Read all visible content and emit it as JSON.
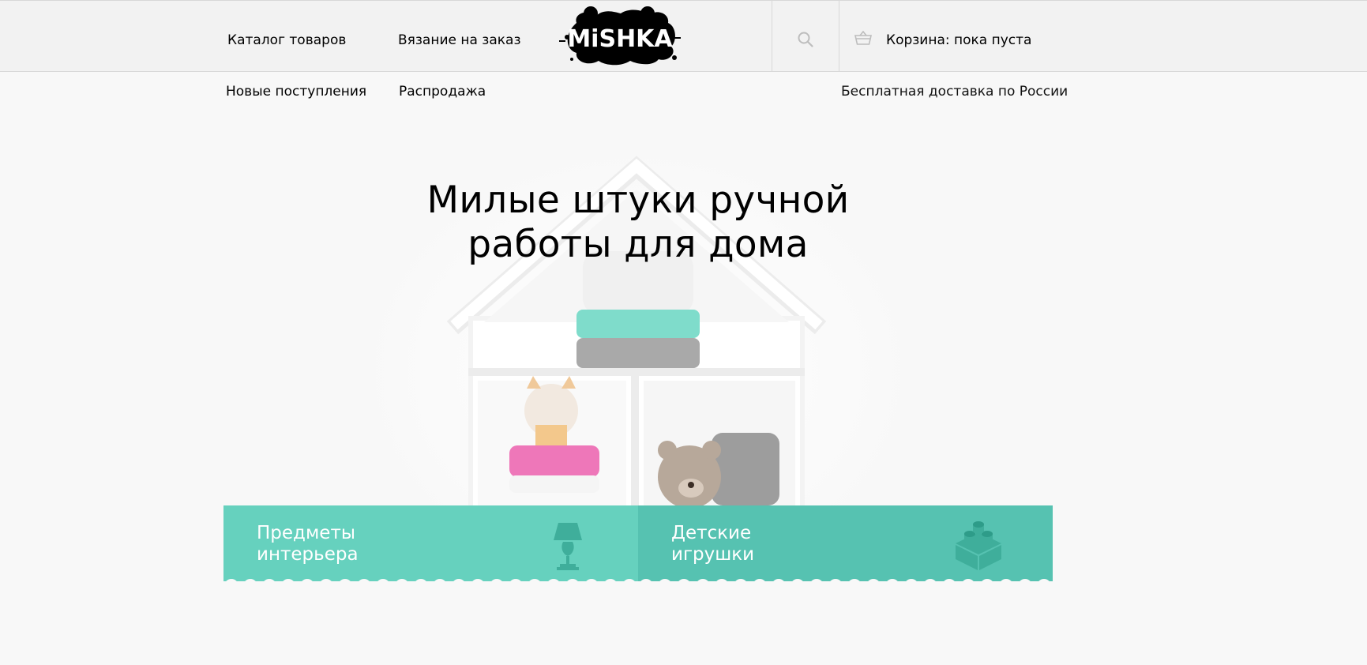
{
  "header": {
    "nav": {
      "catalog": "Каталог товаров",
      "knitting": "Вязание на заказ"
    },
    "logo_text": "MiSHKA",
    "cart_label": "Корзина: пока пуста"
  },
  "subnav": {
    "new_arrivals": "Новые поступления",
    "sale": "Распродажа",
    "delivery_note": "Бесплатная доставка по России"
  },
  "hero": {
    "title_line1": "Милые штуки ручной",
    "title_line2": "работы для дома"
  },
  "categories": {
    "interior": "Предметы интерьера",
    "toys": "Детские игрушки"
  },
  "colors": {
    "accent_interior": "#66d1be",
    "accent_toys": "#56c2b1",
    "header_bg": "#f2f2f2",
    "page_bg": "#f8f8f8"
  },
  "icons": [
    "search-icon",
    "basket-icon",
    "lamp-icon",
    "lego-brick-icon"
  ]
}
